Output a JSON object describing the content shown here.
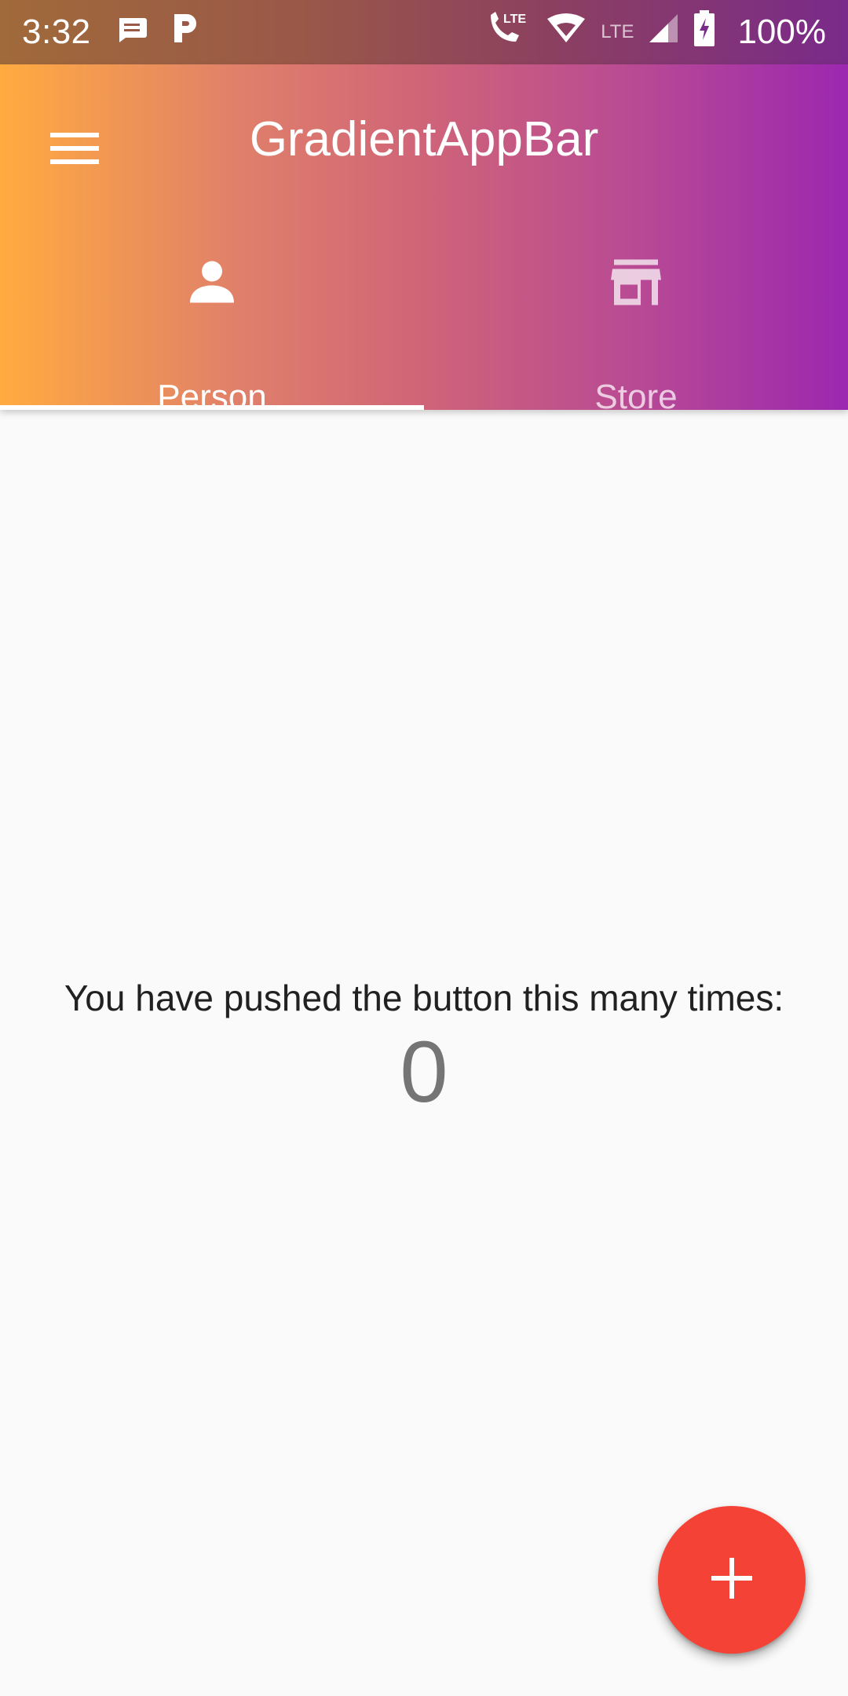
{
  "status_bar": {
    "time": "3:32",
    "battery": "100%",
    "network_label": "LTE",
    "icons": [
      "message-icon",
      "parking-icon",
      "lte-call-icon",
      "wifi-icon",
      "cell-signal-icon",
      "battery-charging-icon"
    ]
  },
  "app_bar": {
    "title": "GradientAppBar",
    "menu_icon": "hamburger-menu-icon",
    "gradient_start": "#ffab40",
    "gradient_end": "#9c27b0"
  },
  "tabs": [
    {
      "label": "Person",
      "icon": "person-icon",
      "selected": true
    },
    {
      "label": "Store",
      "icon": "store-icon",
      "selected": false
    }
  ],
  "main": {
    "caption": "You have pushed the button this many times:",
    "counter": "0"
  },
  "fab": {
    "icon": "add-icon",
    "color": "#f44336"
  }
}
